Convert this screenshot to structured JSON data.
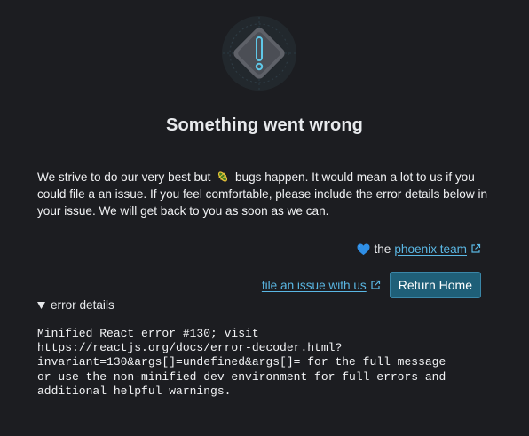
{
  "error_page": {
    "title": "Something went wrong",
    "message_before": "We strive to do our very best but",
    "message_after": "bugs happen. It would mean a lot to us if you could file a an issue. If you feel comfortable, please include the error details below in your issue. We will get back to you as soon as we can.",
    "credit_prefix": "the",
    "credit_link": "phoenix team",
    "file_issue_link": "file an issue with us",
    "return_button": "Return Home",
    "details_summary": "error details",
    "error_message": "Minified React error #130; visit\nhttps://reactjs.org/docs/error-decoder.html?\ninvariant=130&args[]=undefined&args[]= for the full message\nor use the non-minified dev environment for full errors and\nadditional helpful warnings."
  },
  "icons": {
    "hero": "warning-diamond-icon",
    "bug": "bug-emoji",
    "heart": "blue-heart-emoji",
    "external": "external-link-icon",
    "disclosure": "triangle-down-icon"
  },
  "colors": {
    "background": "#1c1d21",
    "link": "#5ab7e4",
    "button_bg": "#1f5f78",
    "button_border": "#3a86a7",
    "accent": "#5fc8e8",
    "heart": "#2f8fe6"
  }
}
